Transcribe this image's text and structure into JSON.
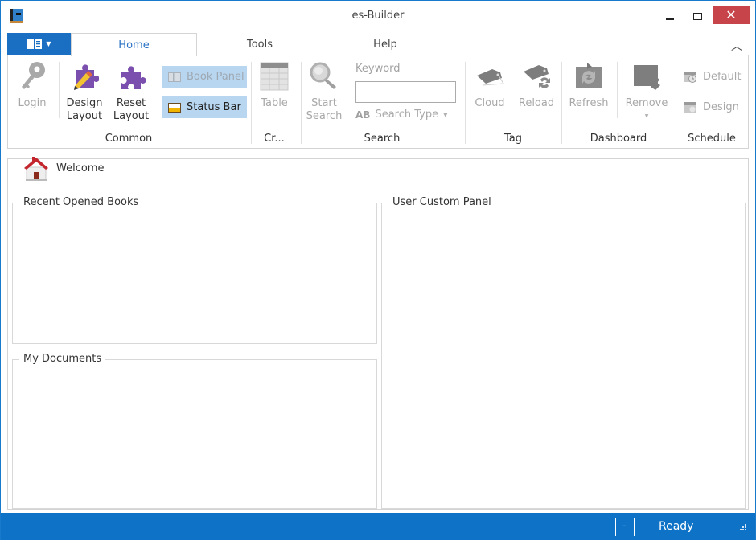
{
  "window": {
    "title": "es-Builder",
    "minimize_label": "Minimize",
    "maximize_label": "Maximize",
    "close_label": "Close"
  },
  "tabs": [
    {
      "label": "Home",
      "active": true
    },
    {
      "label": "Tools",
      "active": false
    },
    {
      "label": "Help",
      "active": false
    }
  ],
  "ribbon": {
    "common": {
      "label": "Common",
      "login": "Login",
      "design_layout": [
        "Design",
        "Layout"
      ],
      "reset_layout": [
        "Reset",
        "Layout"
      ],
      "book_panel": "Book Panel",
      "status_bar": "Status Bar"
    },
    "create": {
      "label": "Cr...",
      "table": "Table"
    },
    "search": {
      "label": "Search",
      "start_search": [
        "Start",
        "Search"
      ],
      "keyword_label": "Keyword",
      "keyword_value": "",
      "search_type_prefix": "AB",
      "search_type": "Search Type"
    },
    "tag": {
      "label": "Tag",
      "cloud": "Cloud",
      "reload": "Reload"
    },
    "dashboard": {
      "label": "Dashboard",
      "refresh": "Refresh",
      "remove": "Remove"
    },
    "schedule": {
      "label": "Schedule",
      "default": "Default",
      "design": "Design"
    }
  },
  "content": {
    "welcome": "Welcome",
    "recent_books": "Recent Opened Books",
    "my_documents": "My Documents",
    "user_custom_panel": "User Custom Panel"
  },
  "statusbar": {
    "indicator": "-",
    "status": "Ready"
  },
  "colors": {
    "accent": "#1b6fc2",
    "statusbar": "#0e72c6",
    "close": "#c7444a",
    "toggle_bg": "#b8d6f0",
    "tab_active_text": "#2a72c4"
  }
}
